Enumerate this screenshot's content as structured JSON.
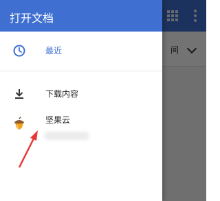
{
  "drawer": {
    "title": "打开文档",
    "recent": {
      "label": "最近",
      "icon": "clock-icon"
    },
    "items": [
      {
        "label": "下载内容",
        "icon": "download-icon"
      },
      {
        "label": "坚果云",
        "icon": "acorn-icon"
      }
    ]
  },
  "background": {
    "sort_label": "间",
    "toolbar_color": "#3f6fd0"
  },
  "annotation": {
    "color": "#e53935"
  }
}
